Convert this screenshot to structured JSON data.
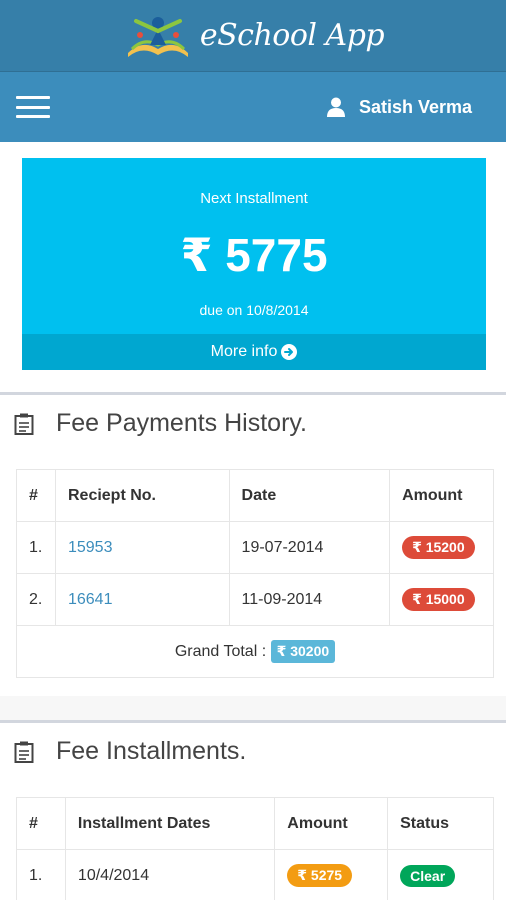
{
  "header": {
    "app_title": "eSchool App",
    "user_name": "Satish Verma"
  },
  "next_installment": {
    "label": "Next Installment",
    "amount": "₹ 5775",
    "due": "due on 10/8/2014",
    "more_info": "More info"
  },
  "payments": {
    "title": "Fee Payments History.",
    "columns": [
      "#",
      "Reciept No.",
      "Date",
      "Amount"
    ],
    "rows": [
      {
        "num": "1.",
        "receipt": "15953",
        "date": "19-07-2014",
        "amount": "₹ 15200"
      },
      {
        "num": "2.",
        "receipt": "16641",
        "date": "11-09-2014",
        "amount": "₹ 15000"
      }
    ],
    "grand_total_label": "Grand Total :",
    "grand_total": "₹ 30200"
  },
  "installments": {
    "title": "Fee Installments.",
    "columns": [
      "#",
      "Installment Dates",
      "Amount",
      "Status"
    ],
    "rows": [
      {
        "num": "1.",
        "date": "10/4/2014",
        "amount": "₹ 5275",
        "status": "Clear"
      }
    ]
  },
  "colors": {
    "brand": "#367fa9",
    "navbar": "#3c8dbc",
    "info_box": "#00c0ef",
    "badge_red": "#dd4b39",
    "badge_orange": "#f39c12",
    "badge_green": "#00a65a"
  },
  "icons": [
    "menu-icon",
    "user-icon",
    "arrow-circle-right-icon",
    "clipboard-icon"
  ]
}
